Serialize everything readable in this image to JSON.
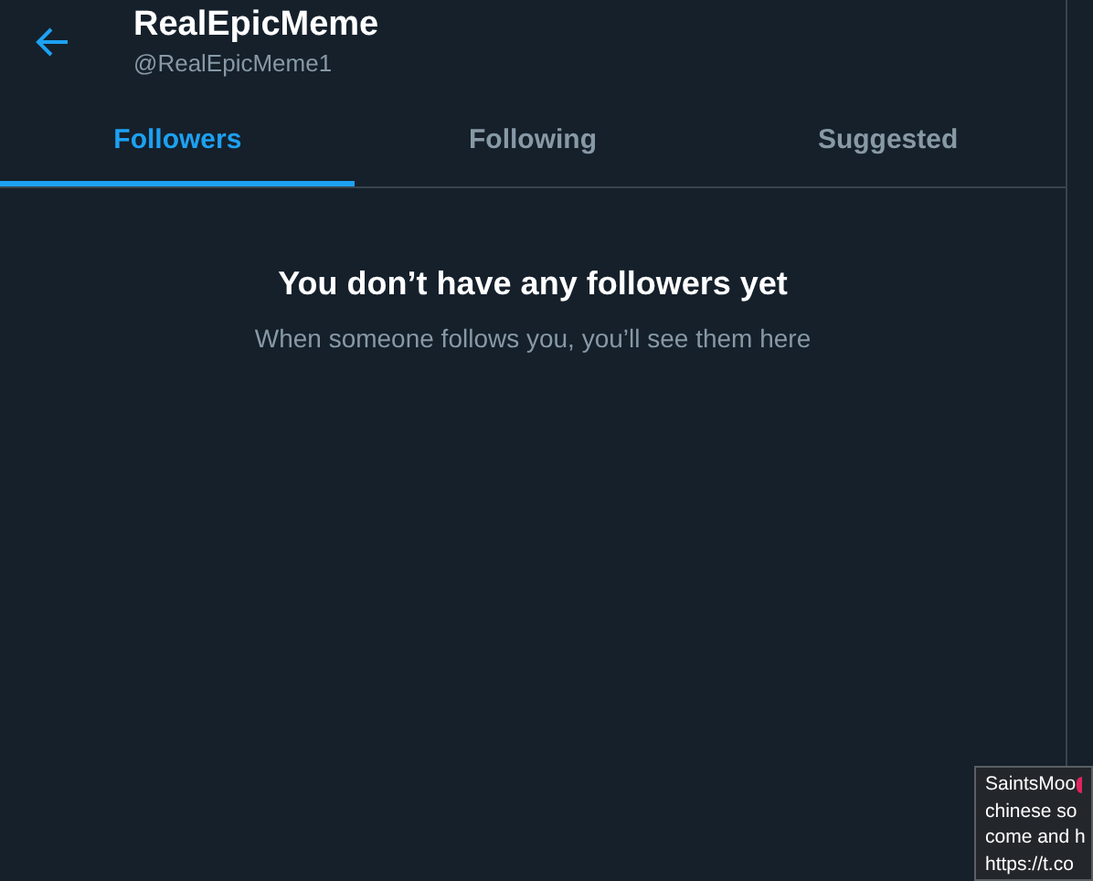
{
  "header": {
    "name": "RealEpicMeme",
    "handle": "@RealEpicMeme1"
  },
  "tabs": [
    {
      "label": "Followers",
      "selected": true
    },
    {
      "label": "Following",
      "selected": false
    },
    {
      "label": "Suggested",
      "selected": false
    }
  ],
  "empty_state": {
    "title": "You don’t have any followers yet",
    "message": "When someone follows you, you’ll see them here"
  },
  "tooltip": {
    "lines": [
      "SaintsMoo",
      "chinese so",
      "come and h",
      "https://t.co"
    ]
  }
}
